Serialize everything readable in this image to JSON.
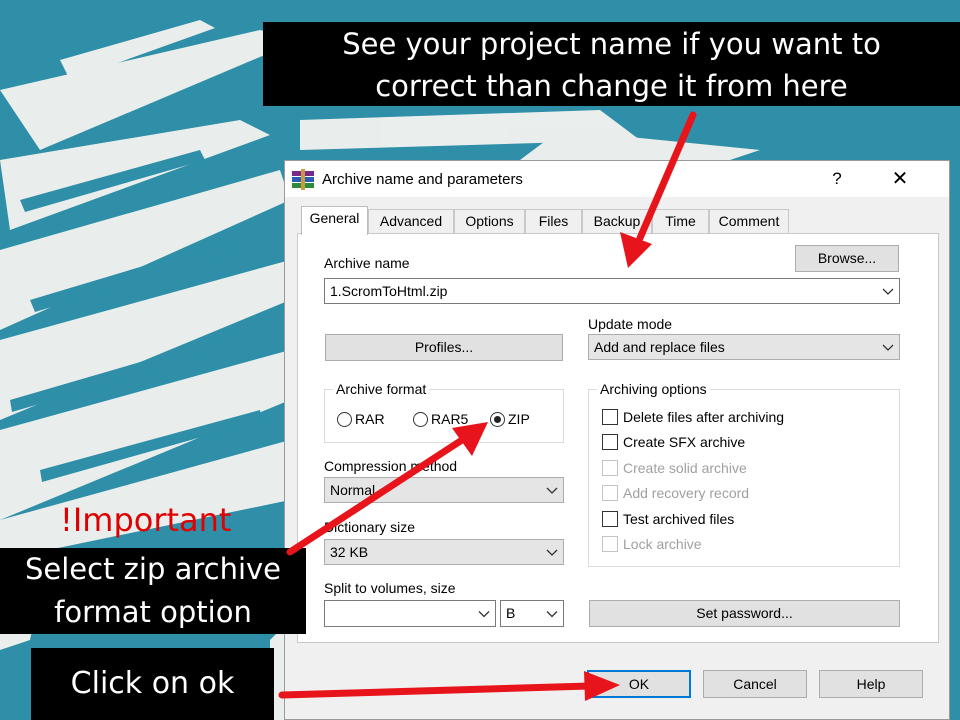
{
  "callouts": {
    "top_line1": "See your project name if you want to",
    "top_line2": "correct than change it from here",
    "important": "!Important",
    "zip_line1": "Select zip archive",
    "zip_line2": "format option",
    "ok": "Click on ok"
  },
  "dialog": {
    "title": "Archive name and parameters",
    "help": "?",
    "close": "✕",
    "tabs": [
      "General",
      "Advanced",
      "Options",
      "Files",
      "Backup",
      "Time",
      "Comment"
    ],
    "browse_label": "Browse...",
    "archive_name_label": "Archive name",
    "archive_name_value": "1.ScromToHtml.zip",
    "update_mode_label": "Update mode",
    "update_mode_value": "Add and replace files",
    "profiles_label": "Profiles...",
    "archive_format_label": "Archive format",
    "formats": [
      "RAR",
      "RAR5",
      "ZIP"
    ],
    "selected_format": "ZIP",
    "archiving_options_label": "Archiving options",
    "options": [
      {
        "label": "Delete files after archiving",
        "enabled": true
      },
      {
        "label": "Create SFX archive",
        "enabled": true
      },
      {
        "label": "Create solid archive",
        "enabled": false
      },
      {
        "label": "Add recovery record",
        "enabled": false
      },
      {
        "label": "Test archived files",
        "enabled": true
      },
      {
        "label": "Lock archive",
        "enabled": false
      }
    ],
    "compression_method_label": "Compression method",
    "compression_method_value": "Normal",
    "dictionary_size_label": "Dictionary size",
    "dictionary_size_value": "32 KB",
    "split_label": "Split to volumes, size",
    "split_value": "",
    "split_unit": "B",
    "set_password_label": "Set password...",
    "ok_label": "OK",
    "cancel_label": "Cancel",
    "help_label": "Help"
  },
  "colors": {
    "background": "#2f8fa8",
    "arrow": "#e8141b",
    "important_text": "#e00000",
    "focus_border": "#0078d7"
  }
}
